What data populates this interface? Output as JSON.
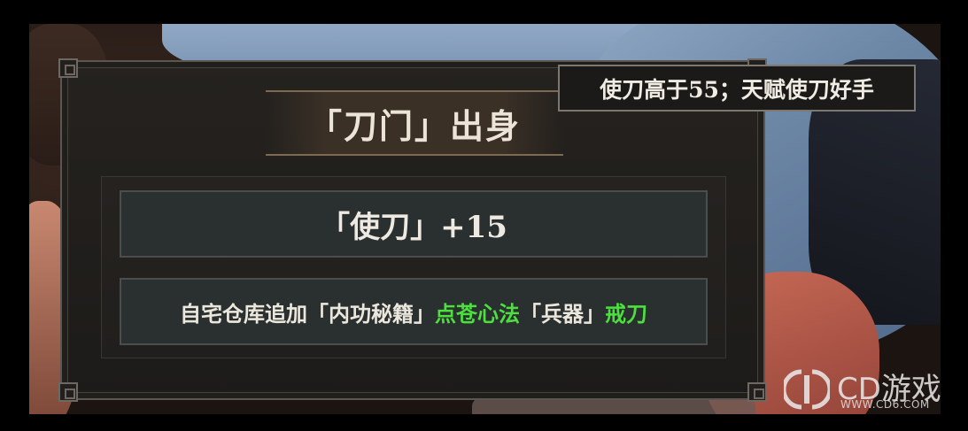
{
  "panel": {
    "title": "「刀门」出身",
    "stat_bonus": "「使刀」+15",
    "reward": {
      "part1": "自宅仓库追加「内功秘籍」",
      "part2": "点苍心法",
      "part3": "「兵器」",
      "part4": "戒刀"
    }
  },
  "tooltip": {
    "text": "使刀高于55；天赋使刀好手"
  },
  "watermark": {
    "name": "CD游戏",
    "url": "WWW.CD6.COM"
  },
  "colors": {
    "highlight_green": "#4ce03e",
    "panel_bg": "#1d1b19",
    "row_bg": "#2a2f2f",
    "title_text": "#ece4d6"
  }
}
